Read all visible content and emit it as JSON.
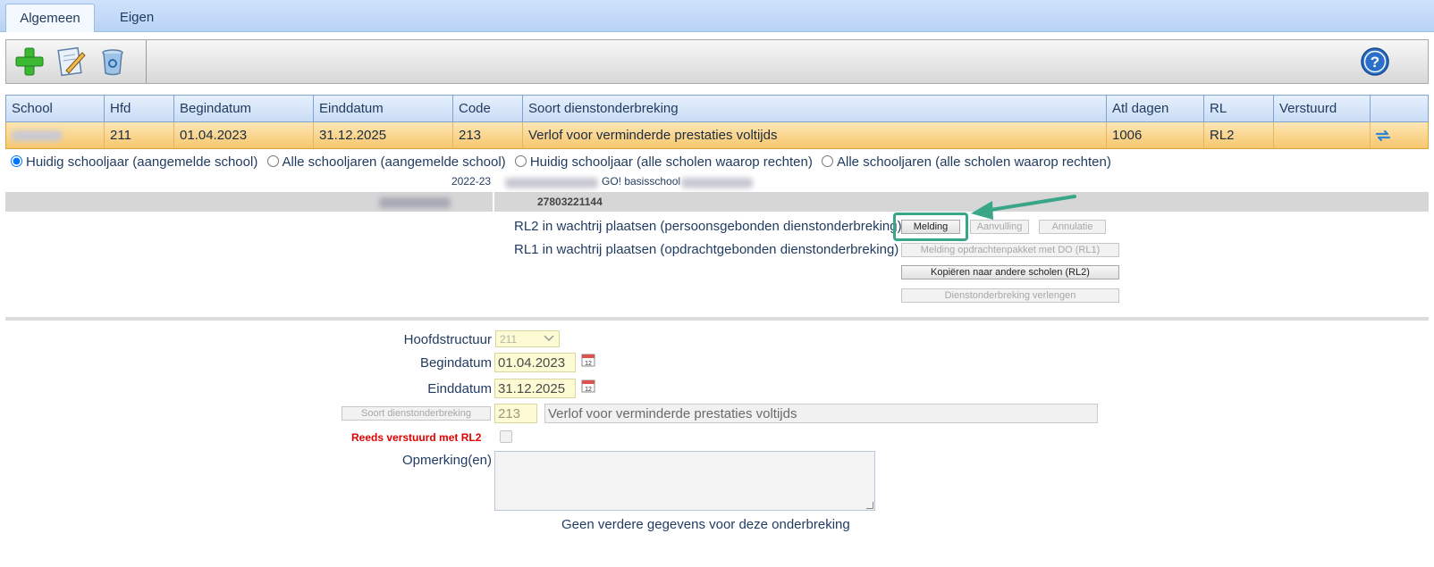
{
  "tabs": [
    {
      "label": "Algemeen"
    },
    {
      "label": "Eigen"
    }
  ],
  "toolbar": {
    "icons": [
      "add-icon",
      "edit-icon",
      "delete-icon",
      "help-icon"
    ]
  },
  "grid": {
    "headers": [
      "School",
      "Hfd",
      "Begindatum",
      "Einddatum",
      "Code",
      "Soort dienstonderbreking",
      "Atl dagen",
      "RL",
      "Verstuurd"
    ],
    "row": {
      "hfd": "211",
      "begindatum": "01.04.2023",
      "einddatum": "31.12.2025",
      "code": "213",
      "soort": "Verlof voor verminderde prestaties voltijds",
      "atl_dagen": "1006",
      "rl": "RL2",
      "verstuurd": ""
    }
  },
  "filters": {
    "options": [
      {
        "label": "Huidig schooljaar (aangemelde school)",
        "selected": true
      },
      {
        "label": "Alle schooljaren (aangemelde school)",
        "selected": false
      },
      {
        "label": "Huidig schooljaar (alle scholen waarop rechten)",
        "selected": false
      },
      {
        "label": "Alle schooljaren (alle scholen waarop rechten)",
        "selected": false
      }
    ]
  },
  "info": {
    "schooljaar": "2022-23",
    "school_name": "GO! basisschool",
    "number": "27803221144"
  },
  "actions": {
    "rl2_label": "RL2 in wachtrij plaatsen (persoonsgebonden dienstonderbreking)",
    "rl1_label": "RL1 in wachtrij plaatsen (opdrachtgebonden dienstonderbreking)",
    "melding": "Melding",
    "aanvulling": "Aanvulling",
    "annulatie": "Annulatie",
    "melding_rl1": "Melding opdrachtenpakket met DO (RL1)",
    "kopieren": "Kopiëren naar andere scholen (RL2)",
    "verlengen": "Dienstonderbreking verlengen"
  },
  "form": {
    "hoofdstructuur_label": "Hoofdstructuur",
    "hoofdstructuur_value": "211",
    "begindatum_label": "Begindatum",
    "begindatum_value": "01.04.2023",
    "einddatum_label": "Einddatum",
    "einddatum_value": "31.12.2025",
    "soort_button": "Soort dienstonderbreking",
    "soort_code": "213",
    "soort_omschrijving": "Verlof voor verminderde prestaties voltijds",
    "reeds_verstuurd_label": "Reeds verstuurd met RL2",
    "opmerkingen_label": "Opmerking(en)",
    "footer": "Geen verdere gegevens voor deze onderbreking"
  },
  "colors": {
    "accent_highlight": "#3aa688",
    "row_selected": "#f7c76d",
    "header_blue": "#c9dcf5",
    "error_red": "#e00000"
  }
}
